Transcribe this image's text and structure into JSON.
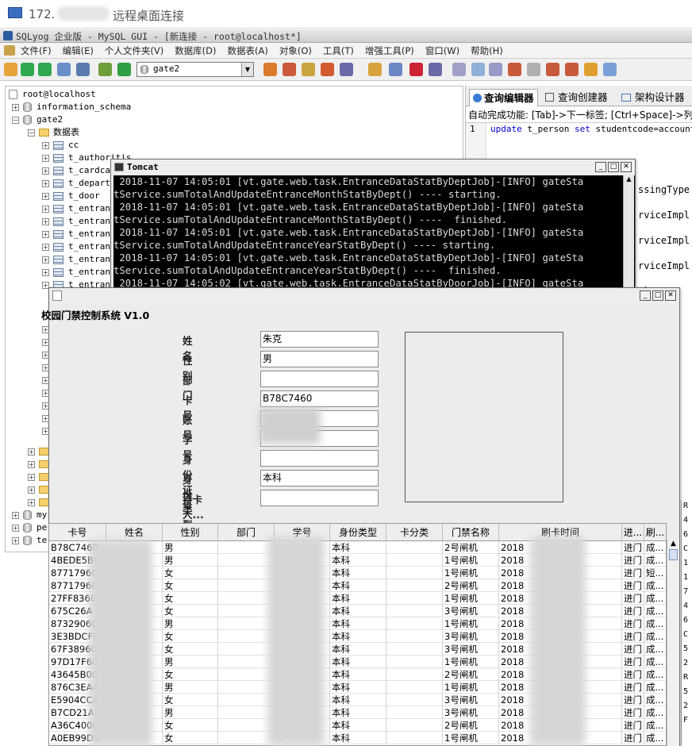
{
  "rdp": {
    "title": "172.",
    "subtitle": "远程桌面连接"
  },
  "app": {
    "title": "SQLyog 企业版 - MySQL GUI - [新连接 - root@localhost*]",
    "menu": [
      "文件(F)",
      "编辑(E)",
      "个人文件夹(V)",
      "数据库(D)",
      "数据表(A)",
      "对象(O)",
      "工具(T)",
      "增强工具(P)",
      "窗口(W)",
      "帮助(H)"
    ],
    "db_select": "gate2"
  },
  "tree": {
    "root": "root@localhost",
    "dbs": [
      "information_schema",
      "gate2"
    ],
    "folder": "数据表",
    "tables": [
      "cc",
      "t_authoritis",
      "t_cardca",
      "t_depart",
      "t_door",
      "t_entran",
      "t_entran",
      "t_entran",
      "t_entran",
      "t_entran",
      "t_entran",
      "t_entran"
    ],
    "bottom": [
      "my",
      "pe",
      "te"
    ]
  },
  "query": {
    "tabs": [
      "查询编辑器",
      "查询创建器",
      "架构设计器"
    ],
    "hint": "自动完成功能: [Tab]->下一标签; [Ctrl+Space]->列",
    "line_no": "1",
    "sql_kw1": "update",
    "sql_t1": " t_person ",
    "sql_kw2": "set",
    "sql_t2": " studentcode=accountno"
  },
  "tomcat": {
    "title": "Tomcat",
    "lines": [
      " 2018-11-07 14:05:01 [vt.gate.web.task.EntranceDataStatByDeptJob]-[INFO] gateSta",
      "tService.sumTotalAndUpdateEntranceMonthStatByDept() ---- starting.",
      " 2018-11-07 14:05:01 [vt.gate.web.task.EntranceDataStatByDeptJob]-[INFO] gateSta",
      "tService.sumTotalAndUpdateEntranceMonthStatByDept() ----  finished.",
      " 2018-11-07 14:05:01 [vt.gate.web.task.EntranceDataStatByDeptJob]-[INFO] gateSta",
      "tService.sumTotalAndUpdateEntranceYearStatByDept() ---- starting.",
      " 2018-11-07 14:05:01 [vt.gate.web.task.EntranceDataStatByDeptJob]-[INFO] gateSta",
      "tService.sumTotalAndUpdateEntranceYearStatByDept() ----  finished.",
      " 2018-11-07 14:05:02 [vt.gate.web.task.EntranceDataStatByDoorJob]-[INFO] gateSta"
    ]
  },
  "right_text": [
    "ssingType",
    "rviceImpl",
    "rviceImpl",
    "rviceImpl",
    "pl",
    "FO",
    "CE",
    "pl",
    "FO",
    "FO",
    "de",
    "FO",
    "00"
  ],
  "far_right": [
    "R",
    "4",
    "6",
    "C",
    "1",
    "1",
    "7",
    "4",
    "6",
    "C",
    "5",
    "2",
    "R",
    "5",
    "2",
    "F"
  ],
  "app2": {
    "title": "校园门禁控制系统 V1.0",
    "form": [
      {
        "label": "姓名",
        "value": "朱克"
      },
      {
        "label": "性别",
        "value": "男"
      },
      {
        "label": "部门",
        "value": ""
      },
      {
        "label": "卡号",
        "value": "B78C7460"
      },
      {
        "label": "账号",
        "value": ""
      },
      {
        "label": "学号",
        "value": ""
      },
      {
        "label": "身份证号",
        "value": ""
      },
      {
        "label": "身份类型",
        "value": "本科"
      },
      {
        "label": "持卡人...",
        "value": ""
      }
    ],
    "columns": [
      "卡号",
      "姓名",
      "性别",
      "部门",
      "学号",
      "身份类型",
      "卡分类",
      "门禁名称",
      "刷卡时间",
      "进...",
      "刷..."
    ],
    "rows": [
      [
        "B78C7460",
        "",
        "男",
        "",
        "",
        "本科",
        "",
        "2号闸机",
        "2018",
        "进门",
        "成..."
      ],
      [
        "4BEDE5BB",
        "",
        "男",
        "",
        "",
        "本科",
        "",
        "1号闸机",
        "2018",
        "进门",
        "成..."
      ],
      [
        "87717960",
        "",
        "女",
        "",
        "2",
        "本科",
        "",
        "1号闸机",
        "2018",
        "进门",
        "短..."
      ],
      [
        "87717960",
        "",
        "女",
        "",
        "2",
        "本科",
        "",
        "2号闸机",
        "2018",
        "进门",
        "成..."
      ],
      [
        "27FF8360",
        "",
        "女",
        "",
        "",
        "本科",
        "",
        "1号闸机",
        "2018",
        "进门",
        "成..."
      ],
      [
        "675C26A",
        "",
        "女",
        "",
        "",
        "本科",
        "",
        "3号闸机",
        "2018",
        "进门",
        "成..."
      ],
      [
        "87329060",
        "",
        "男",
        "",
        "",
        "本科",
        "",
        "1号闸机",
        "2018",
        "进门",
        "成..."
      ],
      [
        "3E3BDCFD",
        "",
        "女",
        "",
        "",
        "本科",
        "",
        "3号闸机",
        "2018",
        "进门",
        "成..."
      ],
      [
        "67F38960",
        "",
        "女",
        "",
        "",
        "本科",
        "",
        "3号闸机",
        "2018",
        "进门",
        "成..."
      ],
      [
        "97D17F60",
        "",
        "男",
        "",
        "",
        "本科",
        "",
        "1号闸机",
        "2018",
        "进门",
        "成..."
      ],
      [
        "43645B00",
        "",
        "女",
        "",
        "",
        "本科",
        "",
        "2号闸机",
        "2018",
        "进门",
        "成..."
      ],
      [
        "876C3EA4",
        "",
        "男",
        "",
        "",
        "本科",
        "",
        "1号闸机",
        "2018",
        "进门",
        "成..."
      ],
      [
        "E5904CCA",
        "",
        "女",
        "",
        "",
        "本科",
        "",
        "3号闸机",
        "2018",
        "进门",
        "成..."
      ],
      [
        "B7CD21A4",
        "",
        "男",
        "",
        "",
        "本科",
        "",
        "3号闸机",
        "2018",
        "进门",
        "成..."
      ],
      [
        "A36C4000",
        "",
        "女",
        "",
        "",
        "本科",
        "",
        "2号闸机",
        "2018",
        "进门",
        "成..."
      ],
      [
        "A0EB99D9",
        "",
        "女",
        "",
        "4",
        "本科",
        "",
        "1号闸机",
        "2018",
        "进门",
        "成..."
      ]
    ]
  }
}
